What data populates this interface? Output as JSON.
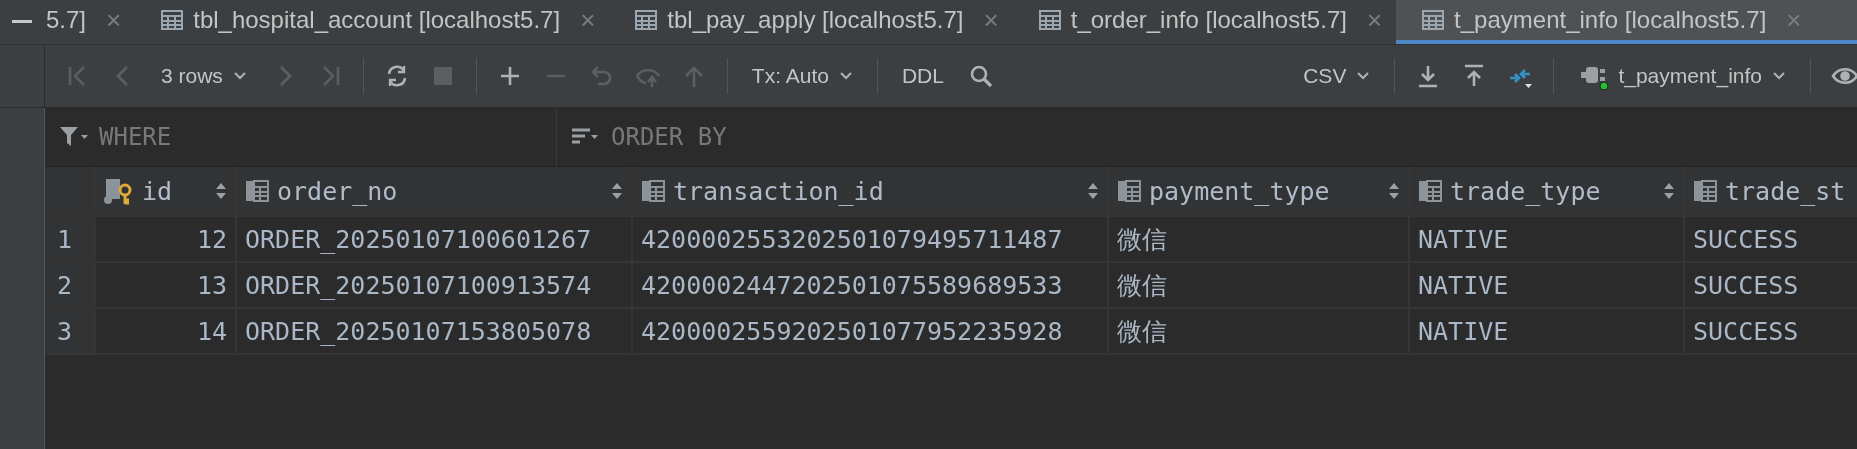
{
  "tabs": [
    {
      "kind": "cut",
      "label": "5.7]",
      "close": "×",
      "selected": false
    },
    {
      "kind": "table",
      "label": "tbl_hospital_account [localhost5.7]",
      "close": "×",
      "selected": false
    },
    {
      "kind": "table",
      "label": "tbl_pay_apply [localhost5.7]",
      "close": "×",
      "selected": false
    },
    {
      "kind": "table",
      "label": "t_order_info [localhost5.7]",
      "close": "×",
      "selected": false
    },
    {
      "kind": "table",
      "label": "t_payment_info [localhost5.7]",
      "close": "×",
      "selected": true
    }
  ],
  "toolbar": [
    {
      "kind": "first",
      "disabled": true
    },
    {
      "kind": "prev",
      "disabled": true
    },
    {
      "kind": "dropdown",
      "label": "3 rows"
    },
    {
      "kind": "next",
      "disabled": true
    },
    {
      "kind": "last",
      "disabled": true
    },
    {
      "kind": "separator"
    },
    {
      "kind": "refresh",
      "disabled": false
    },
    {
      "kind": "stop",
      "disabled": true
    },
    {
      "kind": "separator"
    },
    {
      "kind": "add",
      "disabled": false
    },
    {
      "kind": "remove",
      "disabled": true
    },
    {
      "kind": "revert",
      "disabled": true
    },
    {
      "kind": "preview",
      "disabled": true
    },
    {
      "kind": "submit",
      "disabled": true
    },
    {
      "kind": "separator"
    },
    {
      "kind": "dropdown",
      "label": "Tx: Auto"
    },
    {
      "kind": "separator"
    },
    {
      "kind": "text",
      "label": "DDL"
    },
    {
      "kind": "search",
      "disabled": false
    },
    {
      "kind": "spacer"
    },
    {
      "kind": "dropdown",
      "label": "CSV"
    },
    {
      "kind": "separator"
    },
    {
      "kind": "download",
      "disabled": false
    },
    {
      "kind": "upload",
      "disabled": false
    },
    {
      "kind": "compare",
      "disabled": false
    },
    {
      "kind": "separator"
    },
    {
      "kind": "datasource",
      "label": "t_payment_info",
      "connected": true
    },
    {
      "kind": "separator"
    },
    {
      "kind": "view",
      "disabled": false
    }
  ],
  "filter": {
    "where": {
      "placeholder": "WHERE"
    },
    "order_by": {
      "placeholder": "ORDER BY"
    }
  },
  "table": {
    "columns": [
      {
        "name": "id",
        "kind": "key",
        "sortable": true
      },
      {
        "name": "order_no",
        "kind": "column",
        "sortable": true
      },
      {
        "name": "transaction_id",
        "kind": "column",
        "sortable": true
      },
      {
        "name": "payment_type",
        "kind": "column",
        "sortable": true
      },
      {
        "name": "trade_type",
        "kind": "column",
        "sortable": true
      },
      {
        "name": "trade_st",
        "kind": "column"
      }
    ],
    "rows": [
      {
        "number": "1",
        "cells": [
          "12",
          "ORDER_20250107100601267",
          "4200002553202501079495711487",
          "微信",
          "NATIVE",
          "SUCCESS"
        ]
      },
      {
        "number": "2",
        "cells": [
          "13",
          "ORDER_20250107100913574",
          "4200002447202501075589689533",
          "微信",
          "NATIVE",
          "SUCCESS"
        ]
      },
      {
        "number": "3",
        "cells": [
          "14",
          "ORDER_20250107153805078",
          "4200002559202501077952235928",
          "微信",
          "NATIVE",
          "SUCCESS"
        ]
      }
    ]
  }
}
